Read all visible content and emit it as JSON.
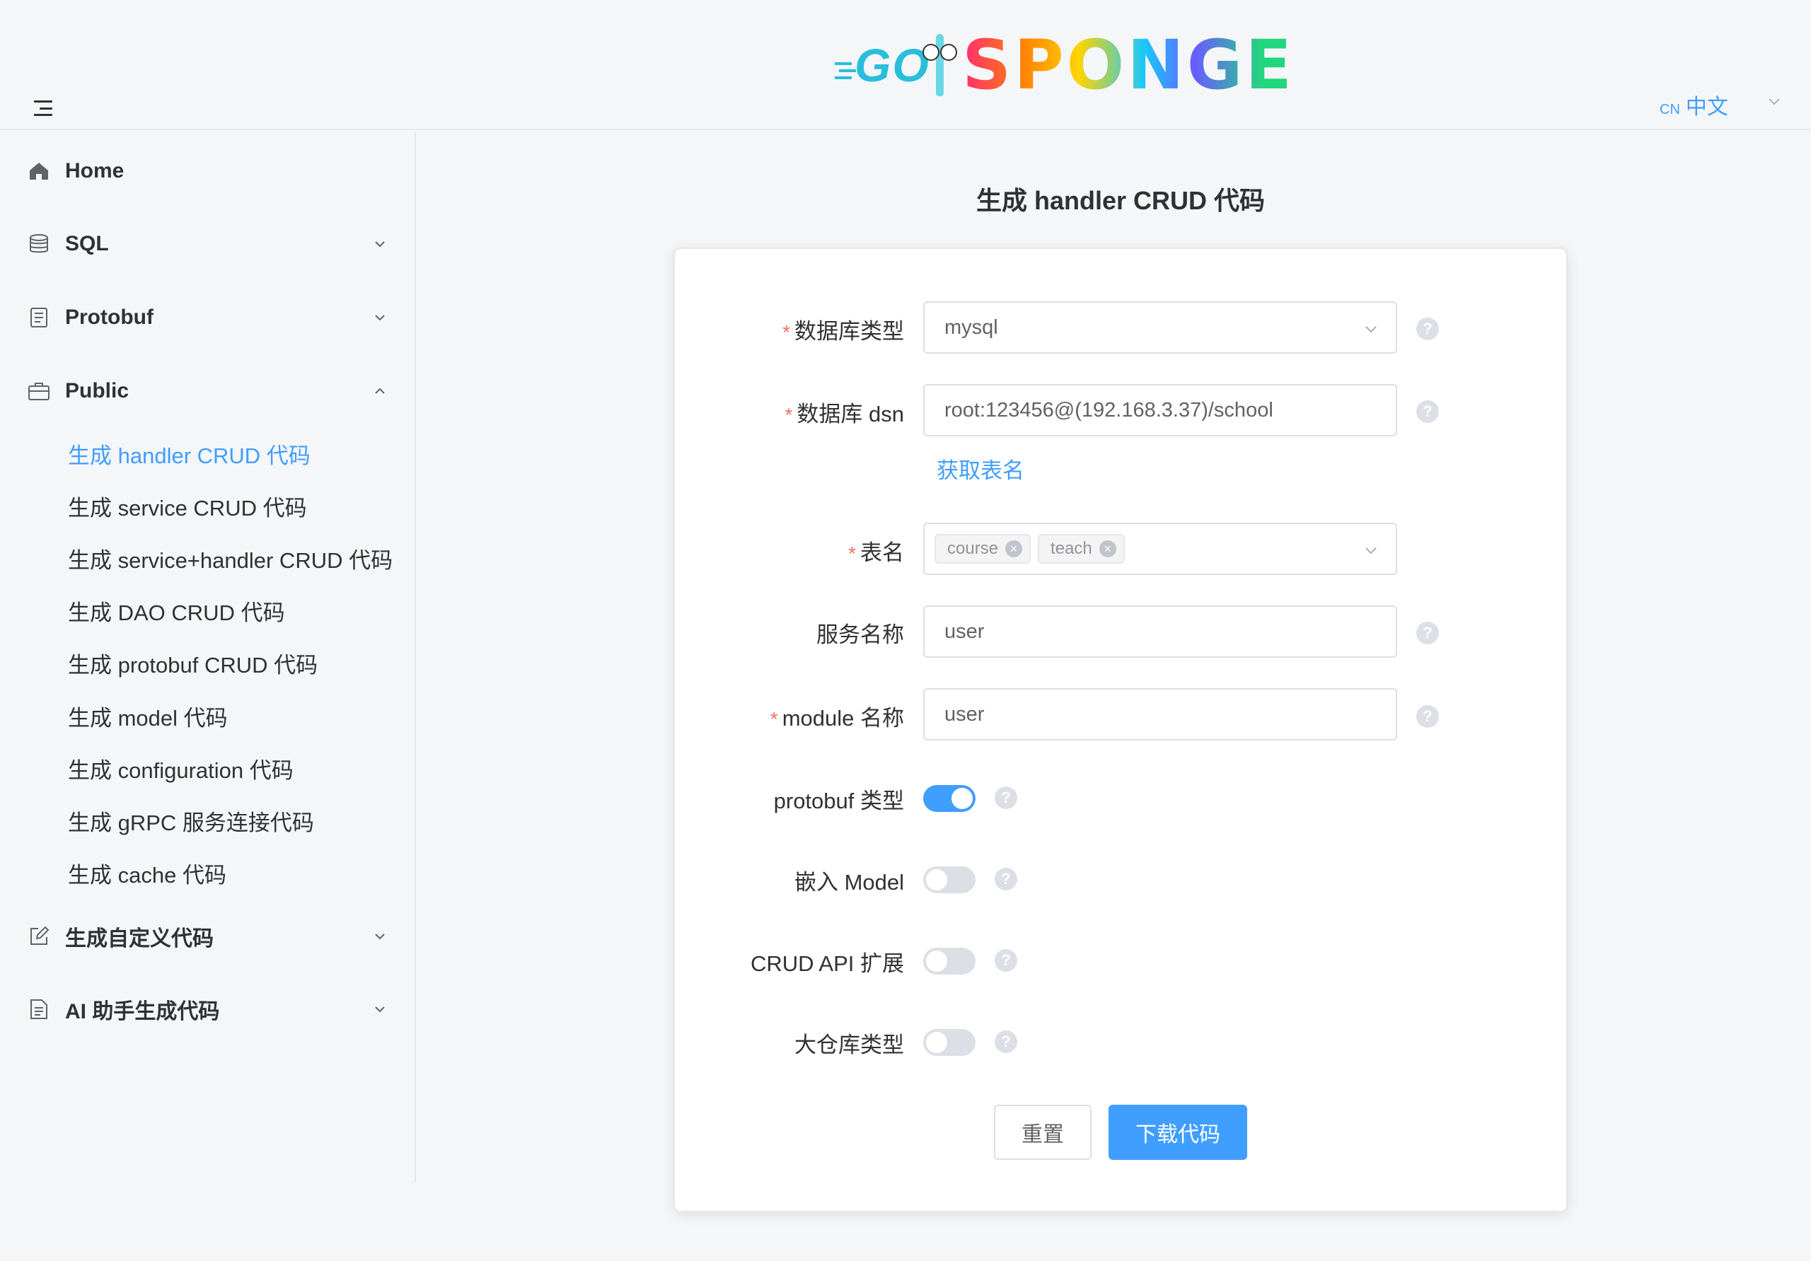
{
  "header": {
    "logo_go": "GO",
    "logo_sponge": "SPONGE",
    "lang_code": "CN",
    "lang_label": "中文"
  },
  "sidebar": {
    "home": "Home",
    "sql": "SQL",
    "protobuf": "Protobuf",
    "public": "Public",
    "public_items": [
      "生成 handler CRUD 代码",
      "生成 service CRUD 代码",
      "生成 service+handler CRUD 代码",
      "生成 DAO CRUD 代码",
      "生成 protobuf CRUD 代码",
      "生成 model 代码",
      "生成 configuration 代码",
      "生成 gRPC 服务连接代码",
      "生成 cache 代码"
    ],
    "custom": "生成自定义代码",
    "ai": "AI 助手生成代码"
  },
  "main": {
    "title": "生成 handler CRUD 代码",
    "form": {
      "db_type_label": "数据库类型",
      "db_type_value": "mysql",
      "dsn_label": "数据库 dsn",
      "dsn_value": "root:123456@(192.168.3.37)/school",
      "fetch_tables": "获取表名",
      "table_label": "表名",
      "tables": [
        "course",
        "teach"
      ],
      "service_label": "服务名称",
      "service_value": "user",
      "module_label": "module 名称",
      "module_value": "user",
      "protobuf_label": "protobuf 类型",
      "protobuf_on": true,
      "embed_label": "嵌入 Model",
      "embed_on": false,
      "crud_ext_label": "CRUD API 扩展",
      "crud_ext_on": false,
      "mono_label": "大仓库类型",
      "mono_on": false,
      "help": "?"
    },
    "reset_button": "重置",
    "download_button": "下载代码"
  }
}
